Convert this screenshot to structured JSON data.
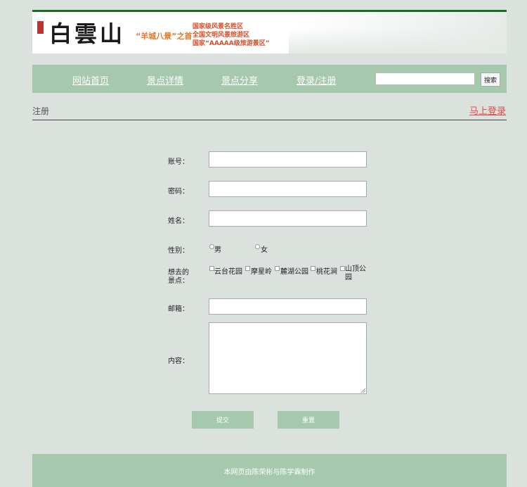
{
  "banner": {
    "brand_text": "白雲山",
    "slogan": "“羊城八景”之首",
    "honors": [
      "国家级风景名胜区",
      "全国文明风景旅游区",
      "国家“AAAAA级旅游景区”"
    ],
    "colors": {
      "top_bar": "#1f6a2a",
      "slogan": "#e2772a",
      "honors": "#d64f2a"
    }
  },
  "nav": {
    "items": [
      "网站首页",
      "景点详情",
      "景点分享",
      "登录/注册"
    ],
    "search_button": "搜索",
    "search_value": "",
    "bg_color": "#a6c8ac"
  },
  "page": {
    "title": "注册",
    "login_link": "马上登录",
    "login_link_color": "#e04b4b"
  },
  "form": {
    "labels": {
      "account": "账号：",
      "password": "密码：",
      "name": "姓名：",
      "gender": "性别：",
      "spots": "想去的景点：",
      "email": "邮箱：",
      "content": "内容："
    },
    "gender_options": [
      "男",
      "女"
    ],
    "spot_options": [
      "云台花园",
      "摩星岭",
      "麓湖公园",
      "桃花涧",
      "山顶公园"
    ],
    "submit_label": "提交",
    "reset_label": "重置"
  },
  "footer": {
    "text": "本网页由陈荣彬与陈学霖制作"
  }
}
